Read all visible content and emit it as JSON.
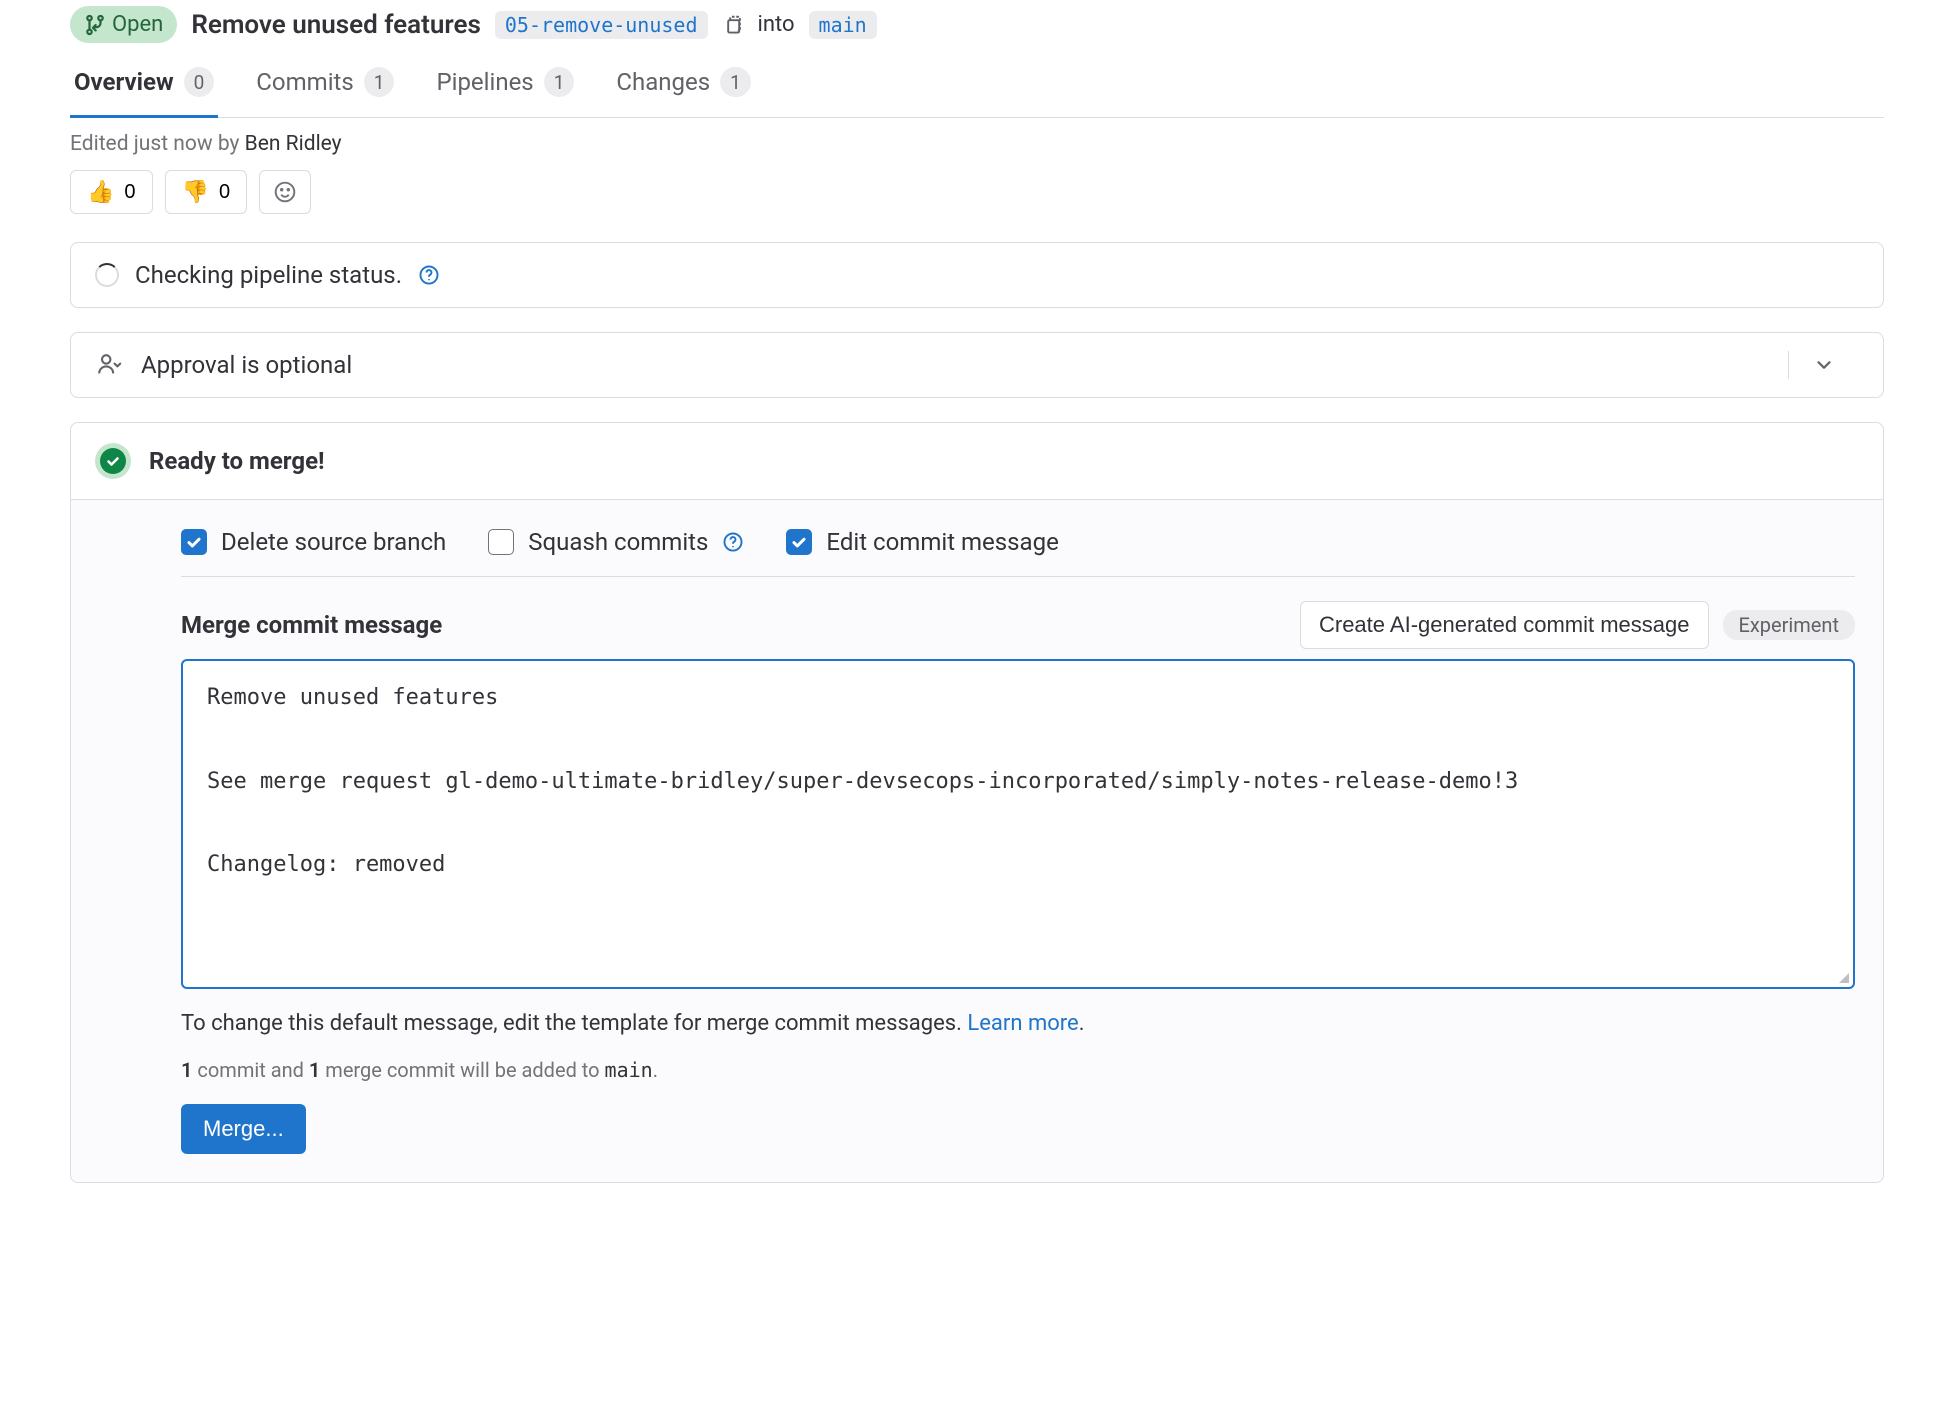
{
  "header": {
    "status_label": "Open",
    "title": "Remove unused features",
    "source_branch": "05-remove-unused",
    "into_label": "into",
    "target_branch": "main"
  },
  "tabs": [
    {
      "label": "Overview",
      "count": "0",
      "active": true
    },
    {
      "label": "Commits",
      "count": "1",
      "active": false
    },
    {
      "label": "Pipelines",
      "count": "1",
      "active": false
    },
    {
      "label": "Changes",
      "count": "1",
      "active": false
    }
  ],
  "edited": {
    "prefix": "Edited just now by ",
    "author": "Ben Ridley"
  },
  "reactions": {
    "thumbs_up_emoji": "👍",
    "thumbs_up_count": "0",
    "thumbs_down_emoji": "👎",
    "thumbs_down_count": "0"
  },
  "pipeline_panel": {
    "text": "Checking pipeline status."
  },
  "approval_panel": {
    "text": "Approval is optional"
  },
  "merge": {
    "ready_title": "Ready to merge!",
    "options": {
      "delete_source": "Delete source branch",
      "squash": "Squash commits",
      "edit_commit": "Edit commit message"
    },
    "commit_msg_title": "Merge commit message",
    "ai_button": "Create AI-generated commit message",
    "experiment_badge": "Experiment",
    "commit_message": "Remove unused features\n\nSee merge request gl-demo-ultimate-bridley/super-devsecops-incorporated/simply-notes-release-demo!3\n\nChangelog: removed",
    "subtext_prefix": "To change this default message, edit the template for merge commit messages. ",
    "subtext_link": "Learn more",
    "subtext_suffix": ".",
    "commit_info_parts": {
      "count1": "1",
      "text1": " commit and ",
      "count2": "1",
      "text2": " merge commit will be added to ",
      "branch": "main",
      "text3": "."
    },
    "merge_button": "Merge..."
  }
}
